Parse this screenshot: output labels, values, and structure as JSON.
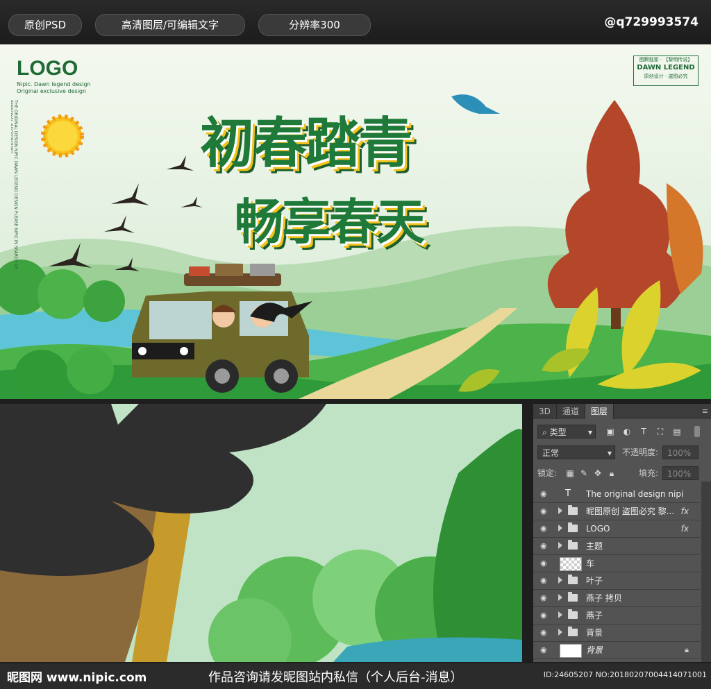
{
  "topbar": {
    "pill1": "原创PSD",
    "pill2": "高清图层/可编辑文字",
    "pill3": "分辨率300",
    "handle": "@q729993574"
  },
  "banner": {
    "logo": "LOGO",
    "logo_sub1": "Nipic. Dawn legend design",
    "logo_sub2": "Original exclusive design",
    "side_text": "THE ORIGINAL DESIGN NIPIC DAWN LEGEND DESIGN PLEASE NIPIC IN SEARCH OF PERSONAL BACKGROUND",
    "title_line1": "初春踏青",
    "title_line2": "畅享春天",
    "stamp_top": "图腾独家 · 【黎明传说】",
    "stamp_main": "DAWN LEGEND",
    "stamp_bottom": "原创设计 · 盗图必究"
  },
  "panel": {
    "tabs": [
      "3D",
      "通道",
      "图层"
    ],
    "filter_label": "类型",
    "blend_mode": "正常",
    "opacity_label": "不透明度:",
    "opacity_value": "100%",
    "lock_label": "锁定:",
    "fill_label": "填充:",
    "fill_value": "100%",
    "layers": [
      {
        "name": "The original design nipic d...",
        "kind": "text"
      },
      {
        "name": "昵图原创 盗图必究 黎...",
        "kind": "folder",
        "fx": "fx"
      },
      {
        "name": "LOGO",
        "kind": "folder",
        "fx": "fx"
      },
      {
        "name": "主题",
        "kind": "folder"
      },
      {
        "name": "车",
        "kind": "image"
      },
      {
        "name": "叶子",
        "kind": "folder"
      },
      {
        "name": "燕子 拷贝",
        "kind": "folder"
      },
      {
        "name": "燕子",
        "kind": "folder"
      },
      {
        "name": "背景",
        "kind": "folder"
      },
      {
        "name": "背景",
        "kind": "background"
      }
    ],
    "text_layer_icon": "T"
  },
  "bottombar": {
    "site": "昵图网 www.nipic.com",
    "message": "作品咨询请发昵图站内私信（个人后台-消息）",
    "id": "ID:24605207 NO:20180207004414071001"
  },
  "colors": {
    "title_green": "#1f7a3a",
    "sky": "#e6f2e6",
    "grass": "#3fae3f",
    "panel": "#535353"
  }
}
